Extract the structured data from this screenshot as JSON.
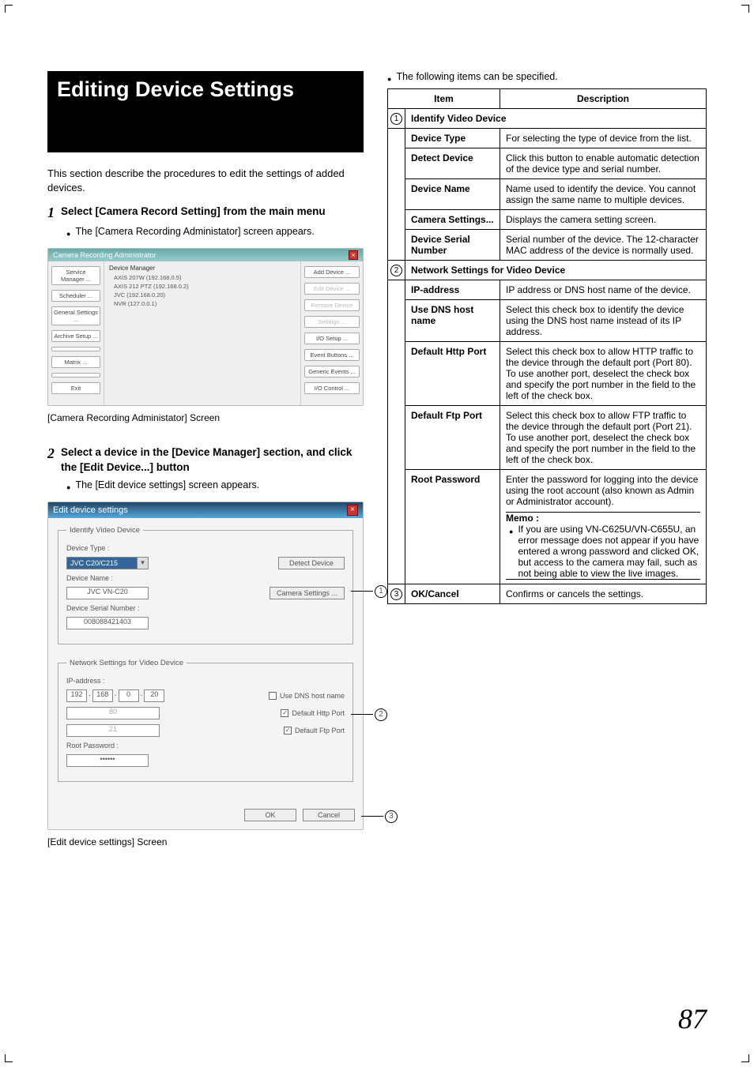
{
  "page_number": "87",
  "title": "Editing Device Settings",
  "intro": "This section describe the procedures to edit the settings of added devices.",
  "step1_num": "1",
  "step1_text": "Select [Camera Record Setting] from the main menu",
  "step1_bullet": "The [Camera Recording Administator] screen appears.",
  "caption1": "[Camera Recording Administator] Screen",
  "step2_num": "2",
  "step2_text": "Select a device in the [Device Manager] section, and click the [Edit Device...] button",
  "step2_bullet": "The [Edit device settings] screen appears.",
  "caption2": "[Edit device settings] Screen",
  "right_lead": "The following items can be specified.",
  "shot1": {
    "title": "Camera Recording Administrator",
    "mid_label": "Device Manager",
    "tree": [
      "AXIS 207W (192.168.0.5)",
      "AXIS 212 PTZ (192.168.0.2)",
      "JVC (192.168.0.20)",
      "NVR (127.0.0.1)"
    ],
    "left_buttons": [
      "Service Manager ...",
      "Scheduler ...",
      "General Settings ...",
      "Archive Setup ...",
      "",
      "Matrix ...",
      "",
      "Exit"
    ],
    "right_buttons": [
      "Add Device ...",
      "Edit Device ...",
      "Remove Device",
      "Settings ...",
      "I/O Setup ...",
      "Event Buttons ...",
      "Generic Events ...",
      "I/O Control ..."
    ]
  },
  "shot2": {
    "title": "Edit device settings",
    "g1_legend": "Identify Video Device",
    "g1_devtype_label": "Device Type :",
    "g1_devtype_value": "JVC C20/C215",
    "g1_detect_btn": "Detect Device",
    "g1_devname_label": "Device Name :",
    "g1_devname_value": "JVC VN-C20",
    "g1_camset_btn": "Camera Settings ...",
    "g1_serial_label": "Device Serial Number :",
    "g1_serial_value": "008088421403",
    "g2_legend": "Network Settings for Video Device",
    "g2_ip_label": "IP-address :",
    "g2_ip": [
      "192",
      "168",
      "0",
      "20"
    ],
    "g2_use_dns": "Use DNS host name",
    "g2_http_port": "80",
    "g2_default_http": "Default Http Port",
    "g2_ftp_port": "21",
    "g2_default_ftp": "Default Ftp Port",
    "g2_root_label": "Root Password :",
    "g2_root_value": "••••••",
    "ok": "OK",
    "cancel": "Cancel"
  },
  "callouts": {
    "c1": "1",
    "c2": "2",
    "c3": "3"
  },
  "table": {
    "h_item": "Item",
    "h_desc": "Description",
    "sec1_num": "1",
    "sec1_title": "Identify Video Device",
    "rows1": [
      {
        "label": "Device Type",
        "desc": "For selecting the type of device from the list."
      },
      {
        "label": "Detect Device",
        "desc": "Click this button to enable automatic detection of the device type and serial number."
      },
      {
        "label": "Device Name",
        "desc": "Name used to identify the device. You cannot assign the same name to multiple devices."
      },
      {
        "label": "Camera Settings...",
        "desc": "Displays the camera setting screen."
      },
      {
        "label": "Device Serial Number",
        "desc": "Serial number of the device. The 12-character MAC address of the device is normally used."
      }
    ],
    "sec2_num": "2",
    "sec2_title": "Network Settings for Video Device",
    "rows2": [
      {
        "label": "IP-address",
        "desc": "IP address or DNS host name of the device."
      },
      {
        "label": "Use DNS host name",
        "desc": "Select this check box to identify the device using the DNS host name instead of its IP address."
      },
      {
        "label": "Default Http Port",
        "desc": "Select this check box to allow HTTP traffic to the device through the default port (Port 80). To use another port, deselect the check box and specify the port number in the field to the left of the check box."
      },
      {
        "label": "Default Ftp Port",
        "desc": "Select this check box to allow FTP traffic to the device through the default port (Port 21). To use another port, deselect the check box and specify the port number in the field to the left of the check box."
      }
    ],
    "root_label": "Root Password",
    "root_desc": "Enter the password for logging into the device using the root account (also known as Admin or Administrator account).",
    "memo_title": "Memo :",
    "memo_text": "If you are using VN-C625U/VN-C655U, an error message does not appear if you have entered a wrong password and clicked OK, but access to the camera may fail, such as not being able to view the live images.",
    "sec3_num": "3",
    "sec3_label": "OK/Cancel",
    "sec3_desc": "Confirms or cancels the settings."
  }
}
